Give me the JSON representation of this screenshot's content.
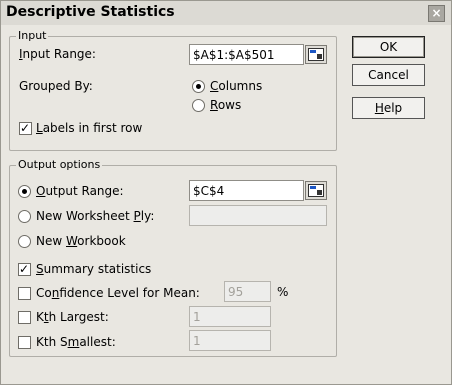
{
  "window": {
    "title": "Descriptive Statistics",
    "close_glyph": "×"
  },
  "input_group": {
    "legend": "Input",
    "input_range_label": "Input Range:",
    "input_range_value": "$A$1:$A$501",
    "grouped_by_label": "Grouped By:",
    "columns_label": "Columns",
    "rows_label": "Rows",
    "labels_first_row_label": "Labels in first row",
    "grouped_by_selected": "Columns",
    "labels_first_row_checked": true
  },
  "output_group": {
    "legend": "Output options",
    "output_range_label": "Output Range:",
    "output_range_value": "$C$4",
    "new_worksheet_label": "New Worksheet Ply:",
    "new_worksheet_value": "",
    "new_workbook_label": "New Workbook",
    "selected_output": "Output Range",
    "summary_statistics_label": "Summary statistics",
    "summary_statistics_checked": true,
    "confidence_label": "Confidence Level for Mean:",
    "confidence_value": "95",
    "percent_sign": "%",
    "confidence_checked": false,
    "kth_largest_label": "Kth Largest:",
    "kth_largest_value": "1",
    "kth_largest_checked": false,
    "kth_smallest_label": "Kth Smallest:",
    "kth_smallest_value": "1",
    "kth_smallest_checked": false
  },
  "buttons": {
    "ok": "OK",
    "cancel": "Cancel",
    "help": "Help"
  },
  "icons": {
    "collapse_dialog": "range-selector-icon"
  }
}
